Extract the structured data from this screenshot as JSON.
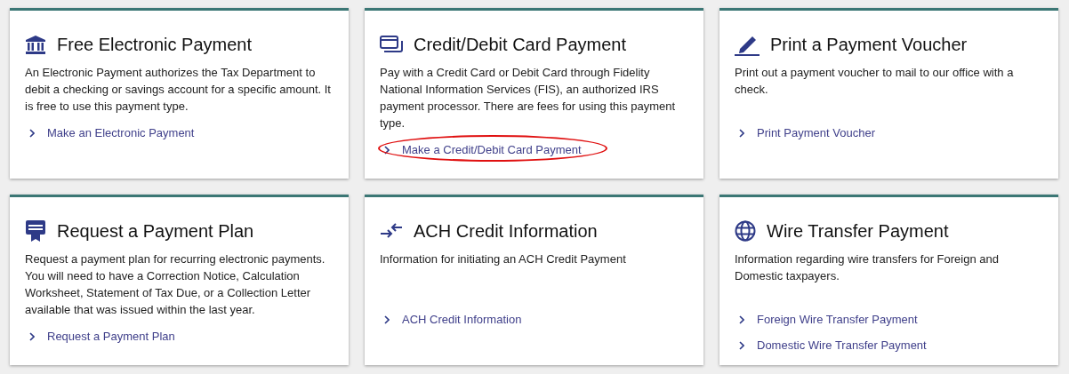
{
  "cards": [
    {
      "title": "Free Electronic Payment",
      "description": "An Electronic Payment authorizes the Tax Department to debit a checking or savings account for a specific amount. It is free to use this payment type.",
      "links": [
        {
          "label": "Make an Electronic Payment",
          "circled": false
        }
      ]
    },
    {
      "title": "Credit/Debit Card Payment",
      "description": "Pay with a Credit Card or Debit Card through Fidelity National Information Services (FIS), an authorized IRS payment processor. There are fees for using this payment type.",
      "links": [
        {
          "label": "Make a Credit/Debit Card Payment",
          "circled": true
        }
      ]
    },
    {
      "title": "Print a Payment Voucher",
      "description": "Print out a payment voucher to mail to our office with a check.",
      "links": [
        {
          "label": "Print Payment Voucher",
          "circled": false
        }
      ]
    },
    {
      "title": "Request a Payment Plan",
      "description": "Request a payment plan for recurring electronic payments. You will need to have a Correction Notice, Calculation Worksheet, Statement of Tax Due, or a Collection Letter available that was issued within the last year.",
      "links": [
        {
          "label": "Request a Payment Plan",
          "circled": false
        }
      ]
    },
    {
      "title": "ACH Credit Information",
      "description": "Information for initiating an ACH Credit Payment",
      "links": [
        {
          "label": "ACH Credit Information",
          "circled": false
        }
      ]
    },
    {
      "title": "Wire Transfer Payment",
      "description": "Information regarding wire transfers for Foreign and Domestic taxpayers.",
      "links": [
        {
          "label": "Foreign Wire Transfer Payment",
          "circled": false
        },
        {
          "label": "Domestic Wire Transfer Payment",
          "circled": false
        }
      ]
    }
  ]
}
